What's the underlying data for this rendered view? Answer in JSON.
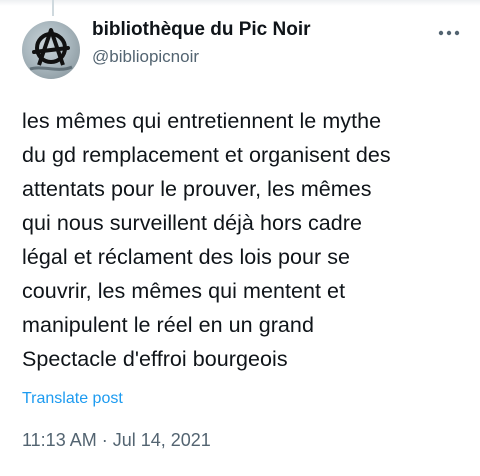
{
  "post": {
    "author": {
      "display_name": "bibliothèque du Pic Noir",
      "handle": "@bibliopicnoir",
      "avatar_icon": "anarchy-symbol-icon"
    },
    "more_icon": "more-options-icon",
    "text_lines": [
      "les mêmes qui entretiennent le mythe",
      "du gd remplacement et organisent des",
      "attentats pour le prouver, les mêmes",
      "qui nous surveillent déjà hors cadre",
      "légal et réclament des lois pour se",
      "couvrir, les mêmes qui mentent et",
      "manipulent le réel en un grand",
      "Spectacle d'effroi bourgeois"
    ],
    "translate_label": "Translate post",
    "timestamp": "11:13 AM · Jul 14, 2021"
  },
  "colors": {
    "text": "#0f1419",
    "secondary": "#536471",
    "link": "#1d9bf0"
  }
}
